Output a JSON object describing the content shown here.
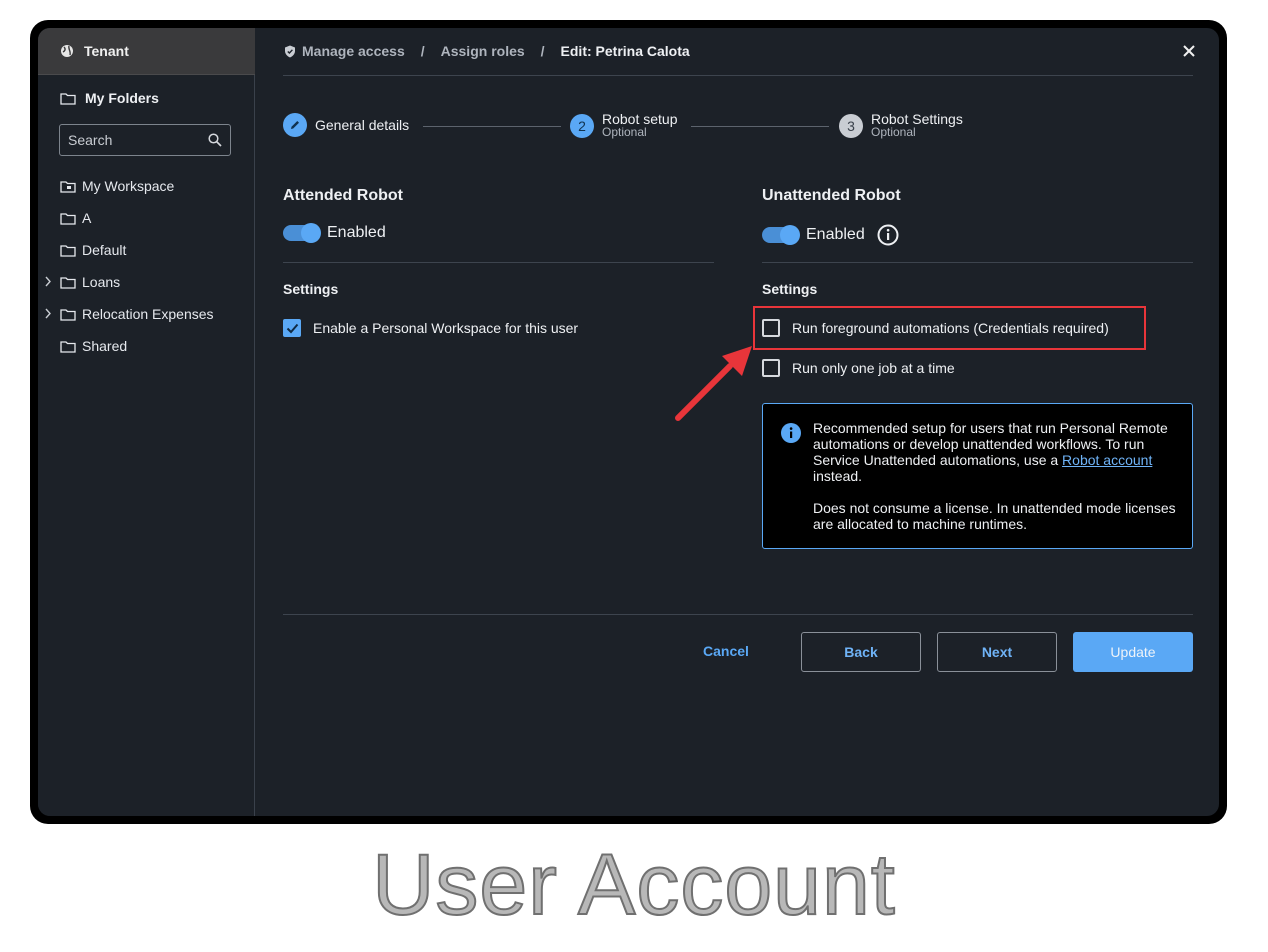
{
  "sidebar": {
    "tenant_label": "Tenant",
    "my_folders_label": "My Folders",
    "search_placeholder": "Search",
    "items": [
      {
        "label": "My Workspace"
      },
      {
        "label": "A"
      },
      {
        "label": "Default"
      },
      {
        "label": "Loans"
      },
      {
        "label": "Relocation Expenses"
      },
      {
        "label": "Shared"
      }
    ]
  },
  "breadcrumb": {
    "items": [
      "Manage access",
      "Assign roles",
      "Edit: Petrina Calota"
    ],
    "separator": "/"
  },
  "stepper": {
    "steps": [
      {
        "number": "",
        "title": "General details",
        "subtitle": ""
      },
      {
        "number": "2",
        "title": "Robot setup",
        "subtitle": "Optional"
      },
      {
        "number": "3",
        "title": "Robot Settings",
        "subtitle": "Optional"
      }
    ]
  },
  "attended": {
    "title": "Attended Robot",
    "toggle_label": "Enabled",
    "settings_label": "Settings",
    "checkbox_label": "Enable a Personal Workspace for this user",
    "checkbox_checked": true
  },
  "unattended": {
    "title": "Unattended Robot",
    "toggle_label": "Enabled",
    "settings_label": "Settings",
    "checkboxes": [
      {
        "label": "Run foreground automations (Credentials required)",
        "checked": false
      },
      {
        "label": "Run only one job at a time",
        "checked": false
      }
    ],
    "info": {
      "para1_before": "Recommended setup for users that run Personal Remote automations or develop unattended workflows. To run Service Unattended automations, use a ",
      "link": "Robot account",
      "para1_after": " instead.",
      "para2": "Does not consume a license. In unattended mode licenses are allocated to machine runtimes."
    }
  },
  "footer": {
    "cancel": "Cancel",
    "back": "Back",
    "next": "Next",
    "update": "Update"
  },
  "caption": "User Account",
  "colors": {
    "accent": "#5aa8f5",
    "highlight": "#e8353a",
    "background": "#1c2128"
  }
}
